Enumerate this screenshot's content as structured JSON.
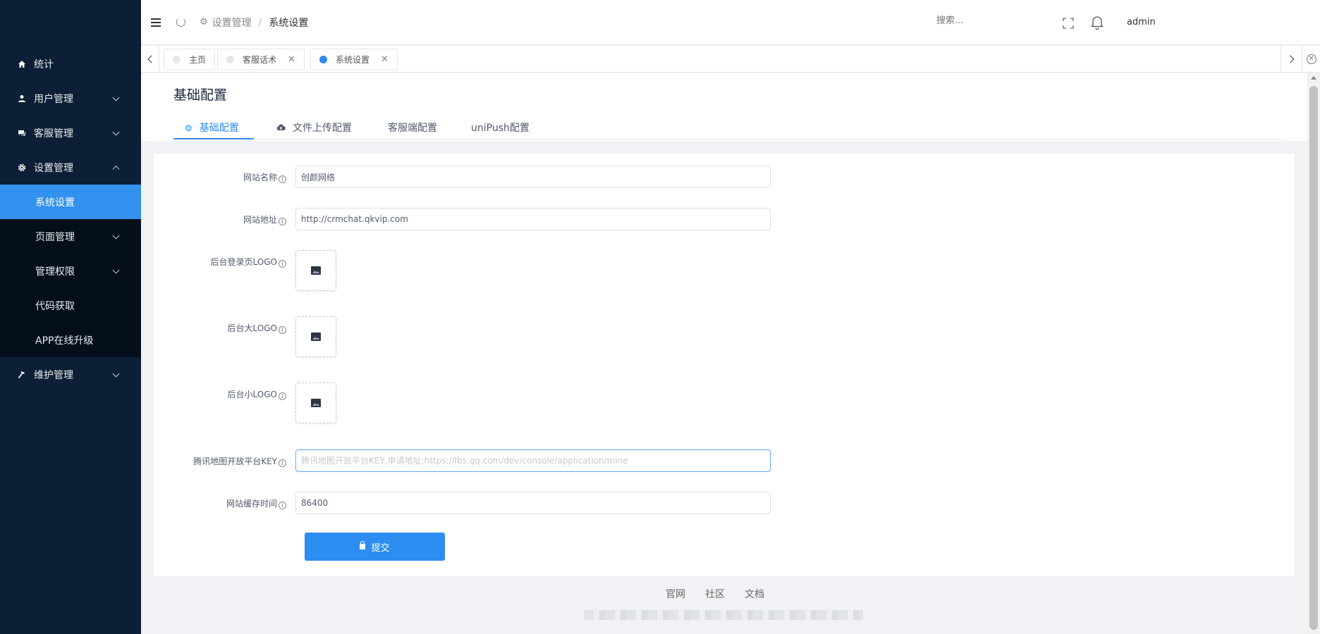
{
  "sidebar": {
    "items": [
      {
        "label": "统计"
      },
      {
        "label": "用户管理"
      },
      {
        "label": "客服管理"
      },
      {
        "label": "设置管理"
      },
      {
        "label": "维护管理"
      }
    ],
    "submenu": [
      {
        "label": "系统设置"
      },
      {
        "label": "页面管理"
      },
      {
        "label": "管理权限"
      },
      {
        "label": "代码获取"
      },
      {
        "label": "APP在线升级"
      }
    ]
  },
  "header": {
    "breadcrumb": [
      "设置管理",
      "系统设置"
    ],
    "search_placeholder": "搜索...",
    "user": "admin"
  },
  "tabs": [
    {
      "label": "主页"
    },
    {
      "label": "客服话术"
    },
    {
      "label": "系统设置"
    }
  ],
  "page": {
    "title": "基础配置",
    "tabs": [
      {
        "label": "基础配置"
      },
      {
        "label": "文件上传配置"
      },
      {
        "label": "客服端配置"
      },
      {
        "label": "uniPush配置"
      }
    ]
  },
  "form": {
    "site_name": {
      "label": "网站名称",
      "value": "创颜网络"
    },
    "site_url": {
      "label": "网站地址",
      "value": "http://crmchat.qkvip.com"
    },
    "login_logo": {
      "label": "后台登录页LOGO"
    },
    "big_logo": {
      "label": "后台大LOGO"
    },
    "small_logo": {
      "label": "后台小LOGO"
    },
    "map_key": {
      "label": "腾讯地图开放平台KEY",
      "value": "",
      "placeholder": "腾讯地图开放平台KEY,申请地址:https://lbs.qq.com/dev/console/application/mine"
    },
    "cache_time": {
      "label": "网站缓存时间",
      "value": "86400"
    },
    "submit_label": "提交"
  },
  "footer": {
    "links": [
      "官网",
      "社区",
      "文档"
    ]
  },
  "colors": {
    "sidebar_bg": "#0c1f36",
    "accent": "#2d8cf0"
  }
}
